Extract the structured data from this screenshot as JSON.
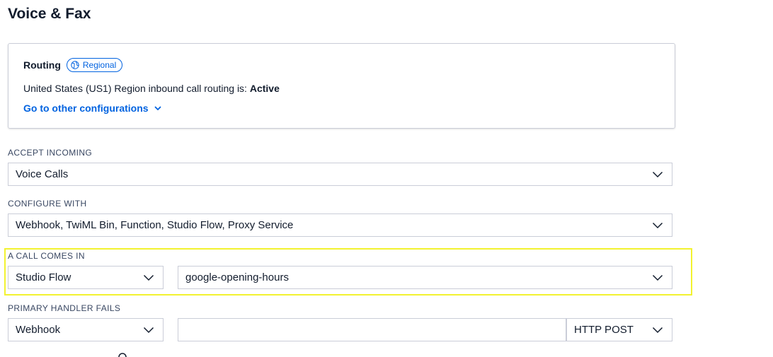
{
  "page": {
    "title": "Voice & Fax"
  },
  "routing": {
    "title": "Routing",
    "badge_label": "Regional",
    "region_text": "United States (US1) Region inbound call routing is: ",
    "status": "Active",
    "config_link": "Go to other configurations"
  },
  "accept_incoming": {
    "label": "ACCEPT INCOMING",
    "value": "Voice Calls"
  },
  "configure_with": {
    "label": "CONFIGURE WITH",
    "value": "Webhook, TwiML Bin, Function, Studio Flow, Proxy Service"
  },
  "call_comes_in": {
    "label": "A CALL COMES IN",
    "type_value": "Studio Flow",
    "flow_value": "google-opening-hours"
  },
  "primary_handler_fails": {
    "label": "PRIMARY HANDLER FAILS",
    "type_value": "Webhook",
    "url_value": "",
    "method_value": "HTTP POST"
  },
  "colors": {
    "link": "#0263e0",
    "highlight": "#f2f230",
    "border": "#cacdd8"
  }
}
